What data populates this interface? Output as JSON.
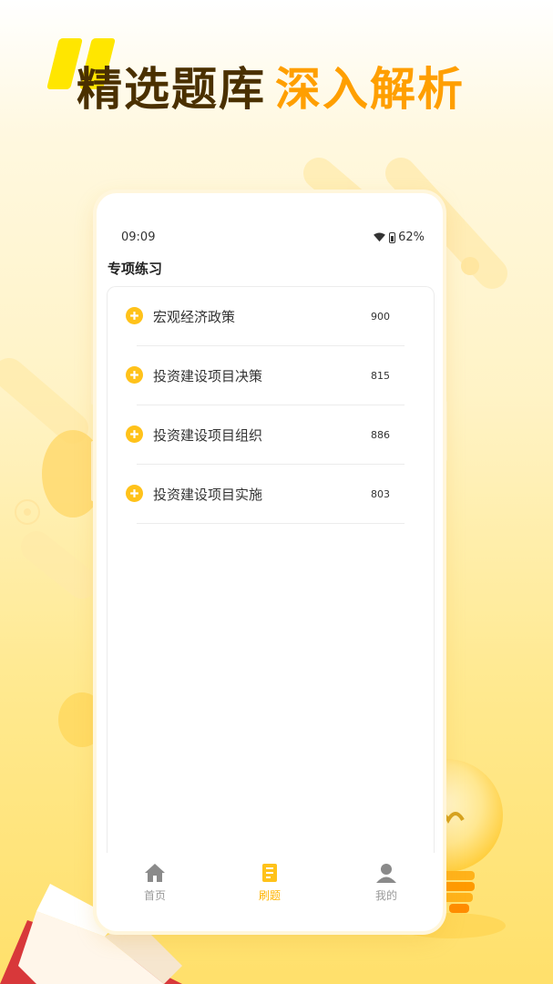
{
  "headline": {
    "part1": "精选题库",
    "part2": "深入解析"
  },
  "status_bar": {
    "time": "09:09",
    "battery": "62%"
  },
  "page": {
    "title": "专项练习"
  },
  "items": [
    {
      "label": "宏观经济政策",
      "count": "900"
    },
    {
      "label": "投资建设项目决策",
      "count": "815"
    },
    {
      "label": "投资建设项目组织",
      "count": "886"
    },
    {
      "label": "投资建设项目实施",
      "count": "803"
    }
  ],
  "tabs": [
    {
      "label": "首页",
      "icon": "home-icon",
      "active": false
    },
    {
      "label": "刷题",
      "icon": "practice-icon",
      "active": true
    },
    {
      "label": "我的",
      "icon": "profile-icon",
      "active": false
    }
  ],
  "colors": {
    "accent": "#ffb400",
    "headline_dark": "#4a3000",
    "headline_accent": "#ff9f00",
    "plus": "#ffc21a"
  }
}
